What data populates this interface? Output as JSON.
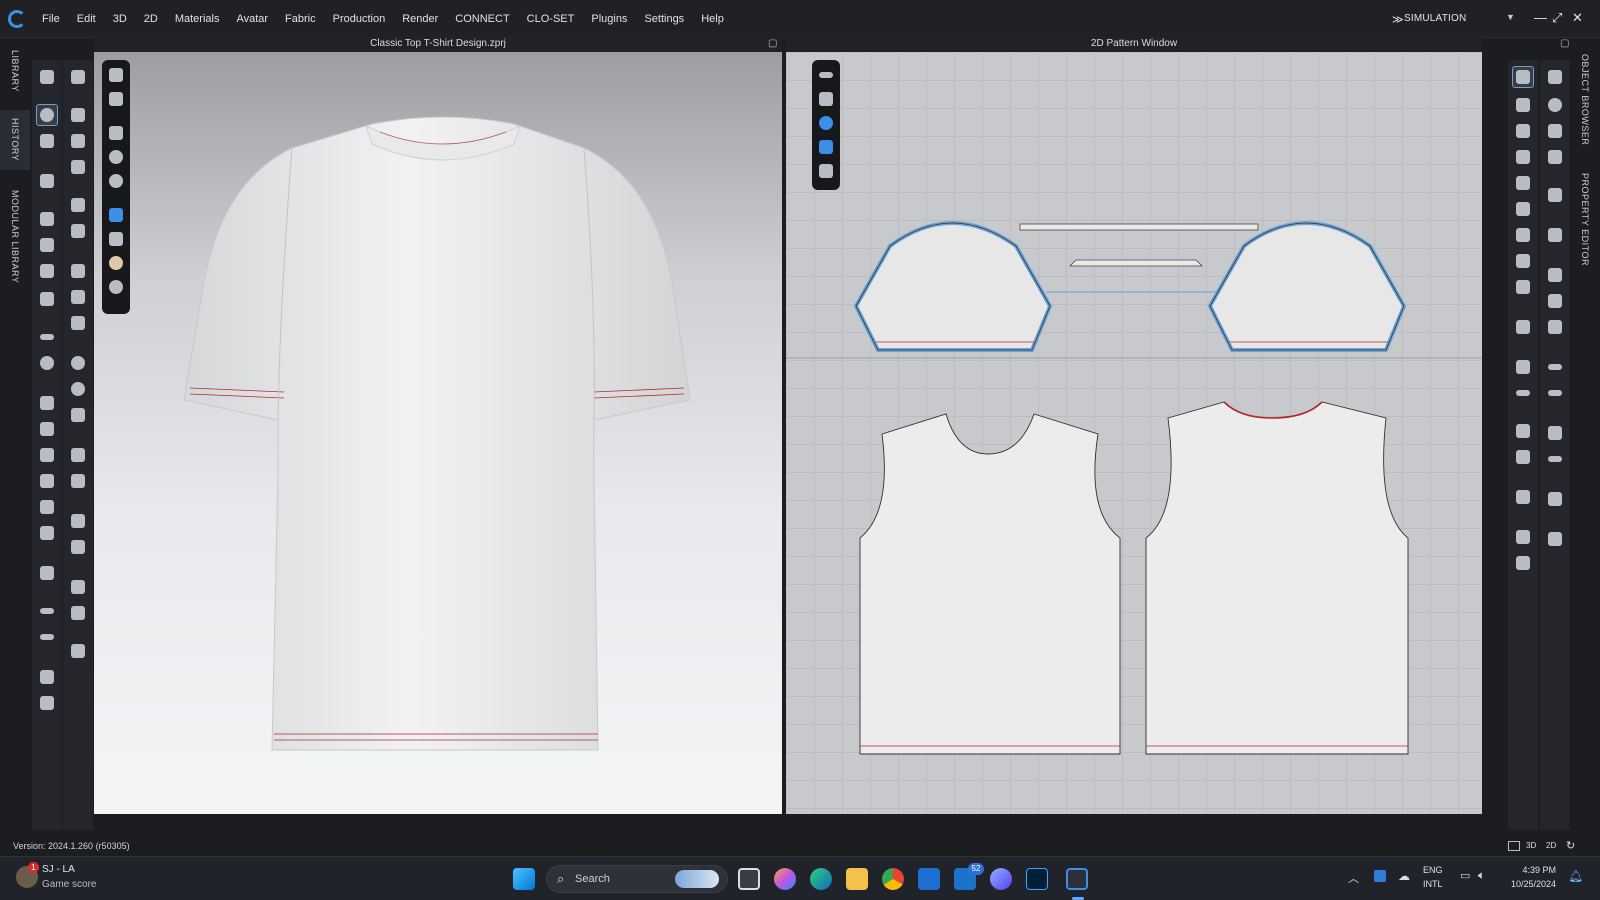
{
  "app": {
    "menu": [
      "File",
      "Edit",
      "3D",
      "2D",
      "Materials",
      "Avatar",
      "Fabric",
      "Production",
      "Render",
      "CONNECT",
      "CLO-SET",
      "Plugins",
      "Settings",
      "Help"
    ],
    "mode": "SIMULATION"
  },
  "left_tabs": [
    "LIBRARY",
    "HISTORY",
    "MODULAR LIBRARY"
  ],
  "right_tabs": [
    "OBJECT BROWSER",
    "PROPERTY EDITOR"
  ],
  "window3d": {
    "title": "Classic Top T-Shirt Design.zprj"
  },
  "window2d": {
    "title": "2D Pattern Window"
  },
  "status": {
    "version": "Version: 2024.1.260 (r50305)"
  },
  "taskbar": {
    "game_title": "SJ - LA",
    "game_subtitle": "Game score",
    "game_badge": "1",
    "search_placeholder": "Search",
    "mail_badge": "52",
    "lang_line1": "ENG",
    "lang_line2": "INTL",
    "time": "4:39 PM",
    "date": "10/25/2024"
  },
  "colors": {
    "accent": "#3b8fe6",
    "seam_outline": "#6aa3d6",
    "stitch": "#b02a2a"
  }
}
